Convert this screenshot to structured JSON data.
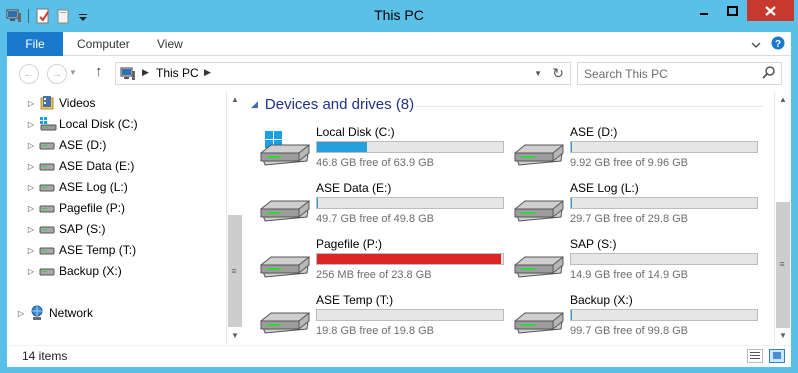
{
  "window": {
    "title": "This PC",
    "controls": [
      "minimize",
      "maximize",
      "close"
    ]
  },
  "quick_access": {
    "icons": [
      "properties-icon",
      "new-folder-icon",
      "customize-dropdown-icon"
    ]
  },
  "ribbon": {
    "tabs": [
      {
        "label": "File",
        "active": true
      },
      {
        "label": "Computer"
      },
      {
        "label": "View"
      }
    ],
    "right_icons": [
      "expand-ribbon-icon",
      "help-icon"
    ]
  },
  "address_bar": {
    "back_icon": "back-arrow-icon",
    "forward_icon": "forward-arrow-icon",
    "up_icon": "up-arrow-icon",
    "breadcrumb": "This PC",
    "search_placeholder": "Search This PC"
  },
  "nav_pane": {
    "items": [
      {
        "label": "Videos",
        "icon": "videos-folder-icon"
      },
      {
        "label": "Local Disk (C:)",
        "icon": "windows-drive-icon"
      },
      {
        "label": "ASE (D:)",
        "icon": "drive-icon"
      },
      {
        "label": "ASE Data (E:)",
        "icon": "drive-icon"
      },
      {
        "label": "ASE Log (L:)",
        "icon": "drive-icon"
      },
      {
        "label": "Pagefile (P:)",
        "icon": "drive-icon"
      },
      {
        "label": "SAP (S:)",
        "icon": "drive-icon"
      },
      {
        "label": "ASE Temp (T:)",
        "icon": "drive-icon"
      },
      {
        "label": "Backup (X:)",
        "icon": "drive-icon"
      }
    ],
    "network": {
      "label": "Network",
      "icon": "network-icon"
    }
  },
  "content": {
    "group_title": "Devices and drives (8)",
    "drives": [
      {
        "name": "Local Disk (C:)",
        "free": "46.8 GB free of 63.9 GB",
        "used_fraction": 0.27,
        "low_space": false,
        "system": true
      },
      {
        "name": "ASE (D:)",
        "free": "9.92 GB free of 9.96 GB",
        "used_fraction": 0.004,
        "low_space": false,
        "system": false
      },
      {
        "name": "ASE Data (E:)",
        "free": "49.7 GB free of 49.8 GB",
        "used_fraction": 0.002,
        "low_space": false,
        "system": false
      },
      {
        "name": "ASE Log (L:)",
        "free": "29.7 GB free of 29.8 GB",
        "used_fraction": 0.003,
        "low_space": false,
        "system": false
      },
      {
        "name": "Pagefile (P:)",
        "free": "256 MB free of 23.8 GB",
        "used_fraction": 0.99,
        "low_space": true,
        "system": false
      },
      {
        "name": "SAP (S:)",
        "free": "14.9 GB free of 14.9 GB",
        "used_fraction": 0.0,
        "low_space": false,
        "system": false
      },
      {
        "name": "ASE Temp (T:)",
        "free": "19.8 GB free of 19.8 GB",
        "used_fraction": 0.0,
        "low_space": false,
        "system": false
      },
      {
        "name": "Backup (X:)",
        "free": "99.7 GB free of 99.8 GB",
        "used_fraction": 0.001,
        "low_space": false,
        "system": false
      }
    ]
  },
  "status_bar": {
    "item_count": "14 items",
    "view_icons": [
      "details-view-icon",
      "large-icons-view-icon"
    ]
  },
  "colors": {
    "frame": "#5bc0e8",
    "file_tab": "#1979ca",
    "close_button": "#c7392f",
    "group_title": "#1e3287",
    "bar_normal": "#26a0da",
    "bar_low": "#da2626"
  }
}
